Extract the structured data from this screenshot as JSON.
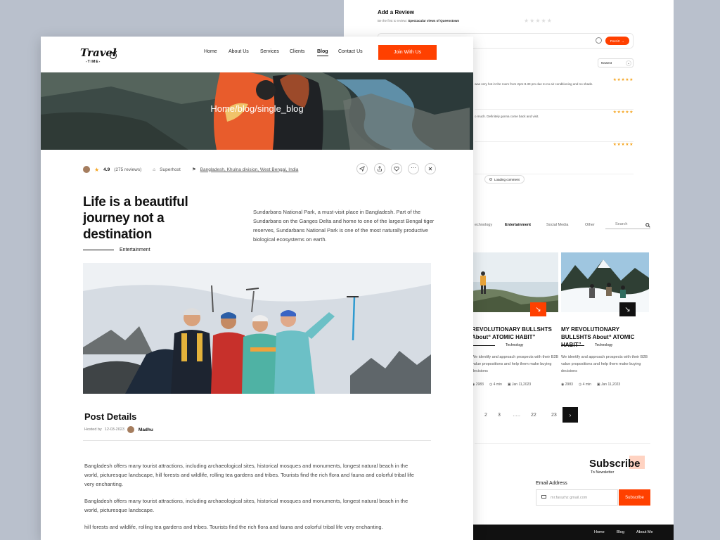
{
  "back": {
    "review": {
      "title": "Add a Review",
      "sub_prefix": "Be the first to review",
      "sub_subject": "Spectacular views of Queenstown",
      "post_label": "Post it!",
      "sort_value": "Newest",
      "rows": [
        {
          "text": "was very hot in the room from 2pm-8.30 pm due to no air conditioning and no shade.",
          "stars": "★★★★★"
        },
        {
          "text": "o much. Definitely gonna come back and visit.",
          "stars": "★★★★★"
        },
        {
          "text": "",
          "stars": "★★★★★"
        }
      ],
      "loading_label": "Loading comment"
    },
    "filters": {
      "tabs": [
        "echnology",
        "Entertainment",
        "Social Media",
        "Other"
      ],
      "search_placeholder": "Search"
    },
    "cards": [
      {
        "title": "REVOLUTIONARY BULLSHTS About“ ATOMIC HABIT”",
        "category": "Technology",
        "desc": "We identify and approach prospects with their B2B value propositions and help them make buying decisions",
        "views": "2983",
        "read": "4 min",
        "date": "Jan 11,2023",
        "arrow_color": "#ff4000"
      },
      {
        "title": "MY REVOLUTIONARY BULLSHTS About“ ATOMIC HABIT”",
        "category": "Technology",
        "desc": "We identify and approach prospects with their B2B value propositions and help them make buying decisions",
        "views": "2983",
        "read": "4 min",
        "date": "Jan 11,2023",
        "arrow_color": "#111111"
      }
    ],
    "pager": [
      "2",
      "3",
      "…..",
      "22",
      "23"
    ],
    "subscribe": {
      "title": "Subscribe",
      "subtitle": "To Newsletter",
      "email_label": "Email Address",
      "email_placeholder": "mr.farazhz gmail.com",
      "button": "Subscribe"
    },
    "footer": [
      "Home",
      "Blog",
      "About Me"
    ]
  },
  "front": {
    "logo": {
      "main": "Travel",
      "sub": "-TIME-"
    },
    "nav": [
      "Home",
      "About Us",
      "Services",
      "Clients",
      "Blog",
      "Contact Us"
    ],
    "nav_active": "Blog",
    "join_button": "Join With Us",
    "breadcrumb": "Home/blog/single_blog",
    "meta": {
      "rating": "4.9",
      "reviews": "(275 reviews)",
      "host": "Superhost",
      "location": "Bangladesh, Khulna division, West Bengal, India"
    },
    "headline": "Life is a beautiful journey not a destination",
    "category": "Entertainment",
    "intro": "Sundarbans National Park, a must-visit place in Bangladesh. Part of the Sundarbans on the Ganges Delta and home to one of the largest Bengal tiger reserves, Sundarbans National Park is one of the most naturally productive biological ecosystems on earth.",
    "post_details": {
      "title": "Post Details",
      "hosted_by": "Hosted by",
      "date": "12-03-2023",
      "author": "Madhu"
    },
    "body": [
      "Bangladesh offers many tourist attractions, including archaeological sites, historical mosques and monuments, longest natural beach in the world, picturesque landscape, hill forests and wildlife, rolling tea gardens and tribes. Tourists find the rich flora and fauna and colorful tribal life very enchanting.",
      "Bangladesh offers many tourist attractions, including archaeological sites, historical mosques and monuments, longest natural beach in the world, picturesque landscape.",
      "hill forests and wildlife, rolling tea gardens and tribes. Tourists find the rich flora and fauna and colorful tribal life very enchanting."
    ]
  },
  "colors": {
    "accent": "#ff4000",
    "background": "#b9c0cc",
    "star": "#f5a623"
  }
}
